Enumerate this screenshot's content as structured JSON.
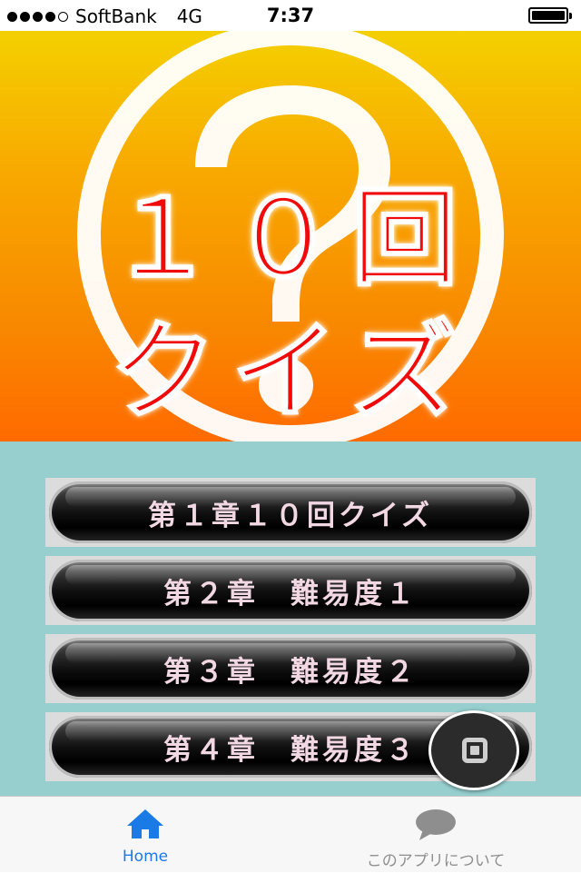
{
  "status_bar": {
    "carrier": "SoftBank",
    "network": "4G",
    "time": "7:37",
    "signal_bars_filled": 4,
    "signal_bars_total": 5
  },
  "banner": {
    "title_line1": "１０回",
    "title_line2": "クイズ",
    "icon": "question-mark-icon",
    "title_color": "#f00a0a"
  },
  "chapters": [
    {
      "label": "第１章１０回クイズ"
    },
    {
      "label": "第２章　難易度１"
    },
    {
      "label": "第３章　難易度２"
    },
    {
      "label": "第４章　難易度３"
    }
  ],
  "fab": {
    "icon": "stop-square-icon"
  },
  "tabbar": {
    "home_label": "Home",
    "home_icon": "house-icon",
    "about_label": "このアプリについて",
    "about_icon": "speech-bubble-icon",
    "active_color": "#1a7be6",
    "inactive_color": "#8e8e8e"
  }
}
